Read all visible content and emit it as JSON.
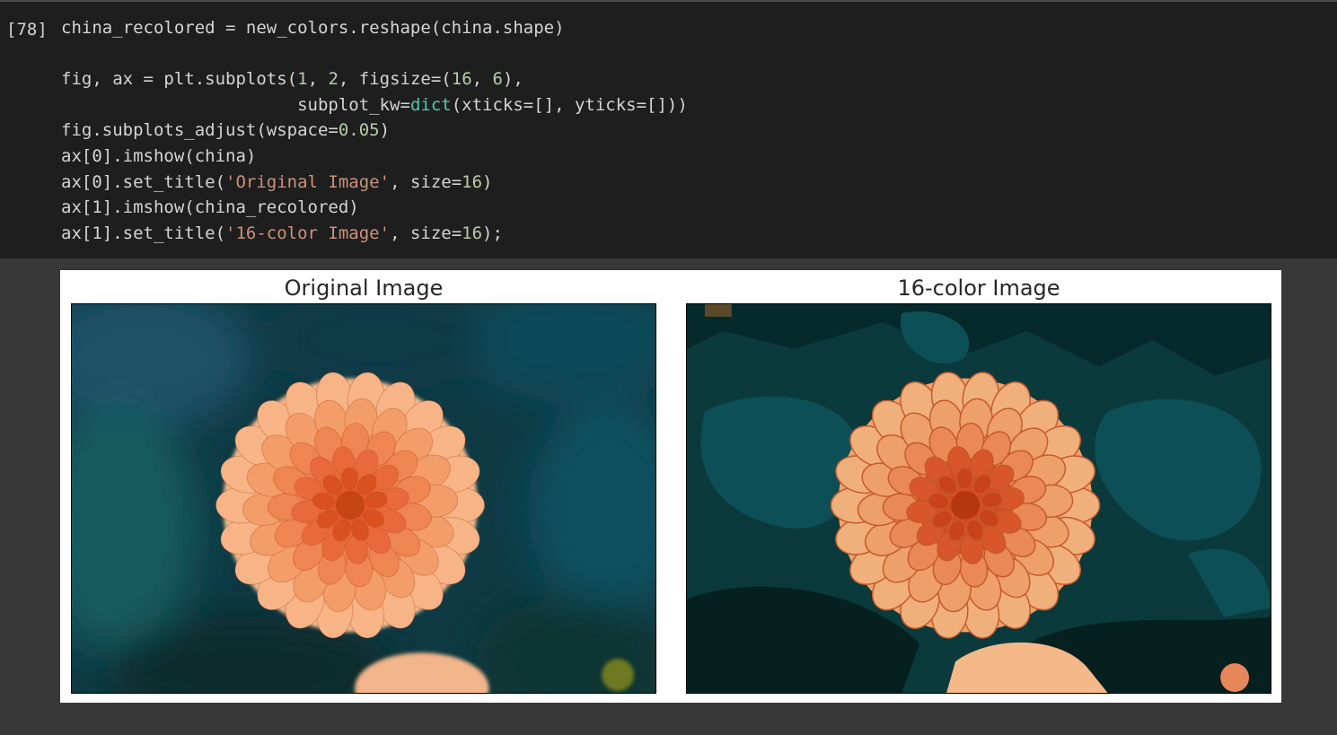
{
  "cell": {
    "execution_count": "[78]",
    "code_lines": [
      "china_recolored = new_colors.reshape(china.shape)",
      "",
      "fig, ax = plt.subplots(1, 2, figsize=(16, 6),",
      "                       subplot_kw=dict(xticks=[], yticks=[]))",
      "fig.subplots_adjust(wspace=0.05)",
      "ax[0].imshow(china)",
      "ax[0].set_title('Original Image', size=16)",
      "ax[1].imshow(china_recolored)",
      "ax[1].set_title('16-color Image', size=16);"
    ]
  },
  "output": {
    "left_title": "Original Image",
    "right_title": "16-color Image",
    "left_image": "photo of an orange dahlia flower on a blurred dark teal background",
    "right_image": "same dahlia photo posterized to 16 colors"
  },
  "colors": {
    "editor_bg": "#1e1e1e",
    "output_bg": "#383838",
    "number": "#b5cea8",
    "string": "#ce9178",
    "builtin": "#4ec9b0",
    "text": "#d4d4d4"
  }
}
